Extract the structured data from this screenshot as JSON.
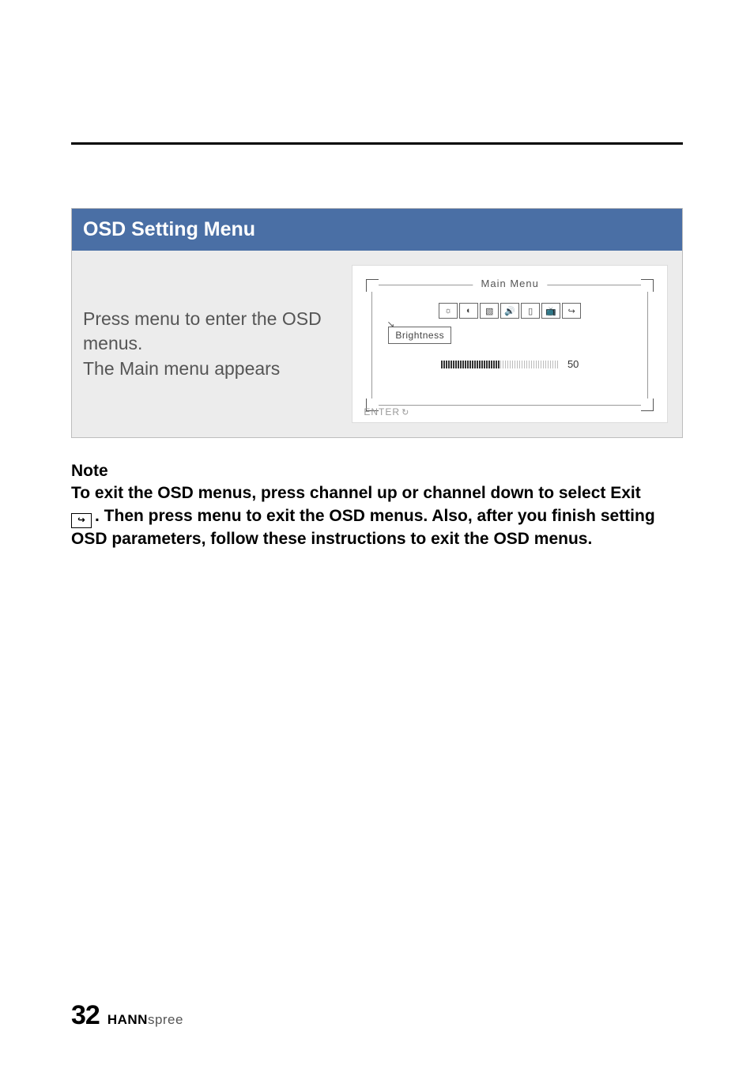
{
  "section": {
    "title": "OSD Setting Menu",
    "instruction_line1": "Press menu to enter the OSD menus.",
    "instruction_line2": "The Main menu appears"
  },
  "osd_diagram": {
    "frame_title": "Main Menu",
    "selected_item": "Brightness",
    "slider_value": "50",
    "enter_label": "ENTER",
    "icons": [
      "sun",
      "contrast",
      "picture",
      "sound",
      "page",
      "tv",
      "exit"
    ]
  },
  "note": {
    "heading": "Note",
    "line1": "To exit the OSD menus, press channel up or channel down to select Exit",
    "line2_after_icon": ". Then press menu to exit the OSD menus. Also, after you finish setting OSD parameters, follow these instructions to exit the OSD menus."
  },
  "footer": {
    "page_number": "32",
    "brand_bold": "HANN",
    "brand_light": "spree"
  }
}
